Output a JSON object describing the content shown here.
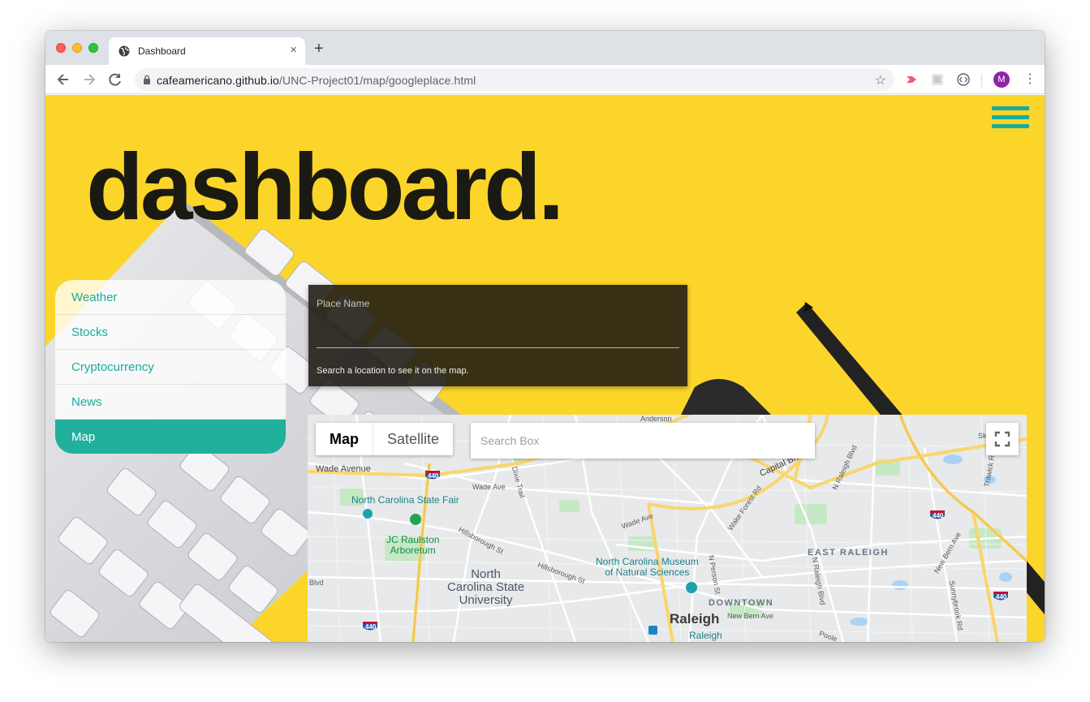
{
  "browser": {
    "tab_title": "Dashboard",
    "tab_close": "×",
    "new_tab": "+",
    "url_host": "cafeamericano.github.io",
    "url_path": "/UNC-Project01/map/googleplace.html",
    "avatar_letter": "M"
  },
  "page": {
    "title": "dashboard.",
    "nav": [
      {
        "label": "Weather",
        "active": false
      },
      {
        "label": "Stocks",
        "active": false
      },
      {
        "label": "Cryptocurrency",
        "active": false
      },
      {
        "label": "News",
        "active": false
      },
      {
        "label": "Map",
        "active": true
      }
    ],
    "place": {
      "label": "Place Name",
      "value": "",
      "help": "Search a location to see it on the map."
    },
    "map": {
      "type_map": "Map",
      "type_satellite": "Satellite",
      "search_placeholder": "Search Box",
      "labels": {
        "wade_avenue": "Wade Avenue",
        "wade_ave": "Wade Ave",
        "wade_ave2": "Wade Ave",
        "nc_state_fair": "North Carolina State Fair",
        "jc_raulston": "JC Raulston\nArboretum",
        "hillsborough": "Hillsborough St",
        "hillsborough2": "Hillsborough St",
        "ncsu": "North\nCarolina State\nUniversity",
        "museum": "North Carolina Museum\nof Natural Sciences",
        "downtown": "DOWNTOWN",
        "raleigh": "Raleigh",
        "raleigh_station": "Raleigh",
        "east_raleigh": "EAST RALEIGH",
        "capital_blvd": "Capital Blvd",
        "new_bern_ave": "New Bern Ave",
        "new_bern_ave2": "New Bern Ave",
        "wake_forest_rd": "Wake Forest Rd",
        "n_raleigh_blvd": "N Raleigh Blvd",
        "n_raleigh_blvd2": "N Raleigh Blvd",
        "n_person_st": "N Person St",
        "dixie_trail": "Dixie Trail",
        "anderson": "Anderson",
        "skycrest": "Skycrest",
        "trawick": "Trawick Rd",
        "sunnybrook": "Sunnybrook Rd",
        "blvd": "Blvd",
        "poole": "Poole",
        "i440": "440"
      }
    }
  },
  "colors": {
    "accent": "#1aac9a",
    "background": "#fcd52b",
    "title": "#1b1a12"
  }
}
